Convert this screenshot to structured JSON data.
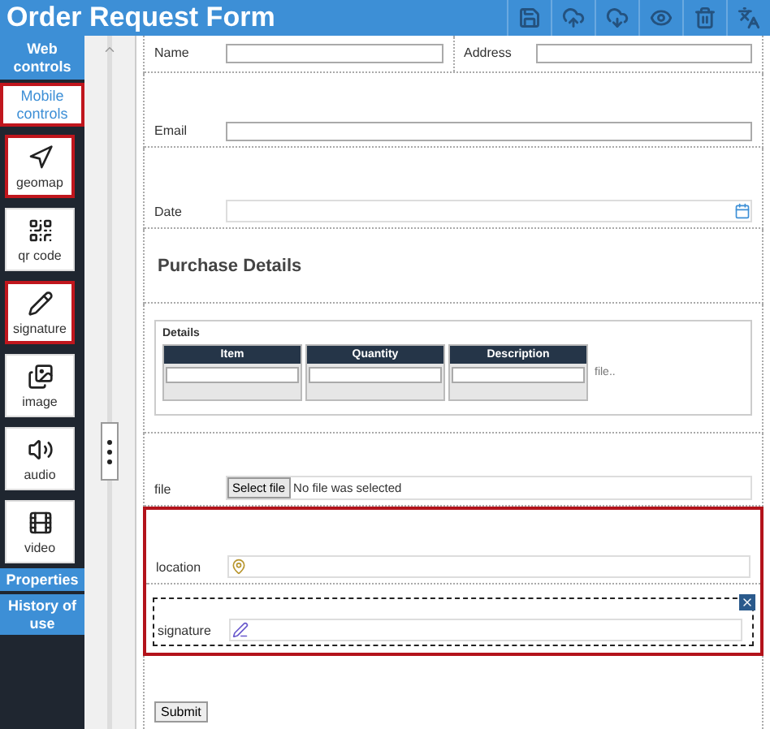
{
  "window": {
    "title": "Order Request Form"
  },
  "sidebar": {
    "tabs": [
      {
        "label": "Web controls",
        "selected": false
      },
      {
        "label": "Mobile controls",
        "selected": true
      }
    ],
    "controls": [
      {
        "kind": "geomap",
        "label": "geomap",
        "selected": true
      },
      {
        "kind": "qrcode",
        "label": "qr code",
        "selected": false
      },
      {
        "kind": "signature",
        "label": "signature",
        "selected": true
      },
      {
        "kind": "image",
        "label": "image",
        "selected": false
      },
      {
        "kind": "audio",
        "label": "audio",
        "selected": false
      },
      {
        "kind": "video",
        "label": "video",
        "selected": false
      }
    ],
    "bottom_tabs": [
      {
        "label": "Properties"
      },
      {
        "label": "History of use"
      }
    ]
  },
  "form": {
    "sections": [
      {
        "kind": "pair",
        "fields": [
          {
            "label": "Name"
          },
          {
            "label": "Address"
          }
        ]
      },
      {
        "kind": "text",
        "label": "Email"
      },
      {
        "kind": "date",
        "label": "Date"
      },
      {
        "kind": "heading",
        "text": "Purchase Details"
      },
      {
        "kind": "table",
        "title": "Details",
        "columns": [
          "Item",
          "Quantity",
          "Description"
        ],
        "note": "file.."
      },
      {
        "kind": "file",
        "label": "file",
        "button": "Select file",
        "status": "No file was selected"
      },
      {
        "kind": "location",
        "label": "location",
        "highlighted": true
      },
      {
        "kind": "signature",
        "label": "signature",
        "highlighted": true,
        "selected": true
      }
    ],
    "submit": "Submit"
  }
}
